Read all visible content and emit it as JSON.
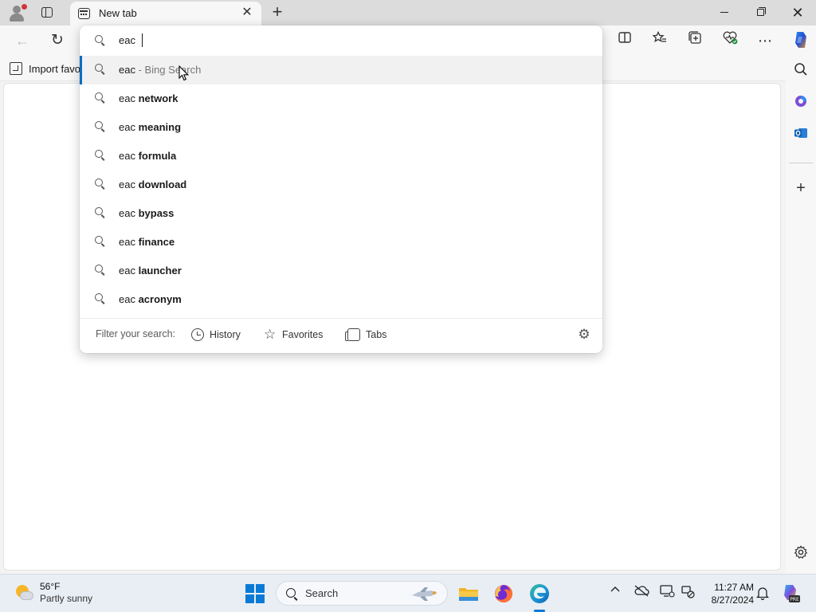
{
  "browser": {
    "tab": {
      "title": "New tab"
    },
    "favorites_bar": {
      "import_label": "Import favo"
    }
  },
  "omnibox": {
    "query": "eac",
    "suggestions": [
      {
        "prefix": "eac",
        "suffix": "",
        "sub": " - Bing Search"
      },
      {
        "prefix": "eac ",
        "suffix": "network",
        "sub": ""
      },
      {
        "prefix": "eac ",
        "suffix": "meaning",
        "sub": ""
      },
      {
        "prefix": "eac ",
        "suffix": "formula",
        "sub": ""
      },
      {
        "prefix": "eac ",
        "suffix": "download",
        "sub": ""
      },
      {
        "prefix": "eac ",
        "suffix": "bypass",
        "sub": ""
      },
      {
        "prefix": "eac ",
        "suffix": "finance",
        "sub": ""
      },
      {
        "prefix": "eac ",
        "suffix": "launcher",
        "sub": ""
      },
      {
        "prefix": "eac ",
        "suffix": "acronym",
        "sub": ""
      }
    ],
    "filter": {
      "label": "Filter your search:",
      "history": "History",
      "favorites": "Favorites",
      "tabs": "Tabs"
    }
  },
  "taskbar": {
    "weather": {
      "temp": "56°F",
      "condition": "Partly sunny"
    },
    "search_label": "Search",
    "time": "11:27 AM",
    "date": "8/27/2024"
  },
  "colors": {
    "accent": "#0f6cbd",
    "windows_blue": "#0a7ad6"
  }
}
